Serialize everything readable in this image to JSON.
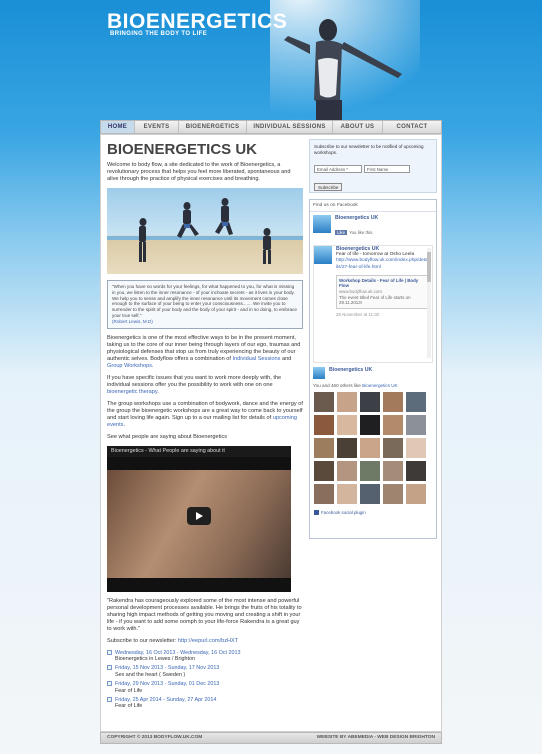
{
  "brand": {
    "logo": "BIOENERGETICS",
    "tagline": "BRINGING THE BODY TO LIFE"
  },
  "nav": [
    {
      "label": "HOME",
      "active": true
    },
    {
      "label": "EVENTS",
      "active": false
    },
    {
      "label": "BIOENERGETICS",
      "active": false
    },
    {
      "label": "INDIVIDUAL SESSIONS",
      "active": false
    },
    {
      "label": "ABOUT US",
      "active": false
    },
    {
      "label": "CONTACT",
      "active": false
    }
  ],
  "main": {
    "title": "BIOENERGETICS UK",
    "intro": "Welcome to body flow, a site dedicated to the work of Bioenergetics, a revolutionary process that helps you feel more liberated, spontaneous and alive through the practice of physical exercises and breathing.",
    "quote": "\"When you have no words for your feelings, for what happened to you, for what is missing in you, we listen to the inner resonance - of your inchoate secrets - as it lives in your body. We help you to sense and amplify the inner resonance until its movement comes close enough to the surface of your being to enter your consciousness....... We invite you to surrender to the spirit of your body and the body of your spirit - and in so doing, to embrace your true self.\"",
    "quote_author": "(Robert Lewis, M.D)",
    "p2_a": "Bioenergetics is one of the most effective ways to be in the present moment, taking us to the core of our inner being through layers of our ego, traumas and physiological defenses that stop us from truly experiencing the beauty of our authentic selves. Bodyflow offers a combination of ",
    "p2_link1": "Individual Sessions",
    "p2_b": " and ",
    "p2_link2": "Group Workshops",
    "p2_c": ".",
    "p3_a": "If you have specific issues that you want to work more deeply with, the individual sessions offer you the possibility to work with one on one ",
    "p3_link": "bioenergetic therapy",
    "p3_b": ".",
    "p4_a": "The group workshops use a combination of bodywork, dance and the energy of the group the bioenergetic workshops are a great way to come back to yourself and start loving life again. Sign up to a our mailing list for details of ",
    "p4_link": "upcoming events",
    "p4_b": ".",
    "p5": "See what people are saying about Bioenergetics",
    "video_title": "Bioenergetics - What People are saying about it",
    "testimonial": "\"Rakendra has courageously explored some of the most intense and powerful personal development processes available. He brings the fruits of his totality to sharing high impact methods of getting you moving and creating a shift in your life - if you want to add some oomph to your life-force Rakendra is a great guy to work with.\"",
    "subscribe_label": "Subscribe to our newsletter: ",
    "subscribe_link": "http://eepurl.com/bzHXT",
    "events": [
      {
        "date": "Wednesday, 16 Oct 2013 - Wednesday, 16 Oct 2013",
        "title": "Bioenergetics in Lewes / Brighton"
      },
      {
        "date": "Friday, 15 Nov 2013 - Sunday, 17 Nov 2013",
        "title": "Sex and the heart ( Sweden )"
      },
      {
        "date": "Friday, 29 Nov 2013 - Sunday, 01 Dec 2013",
        "title": "Fear of Life"
      },
      {
        "date": "Friday, 25 Apr 2014 - Sunday, 27 Apr 2014",
        "title": "Fear of Life"
      }
    ]
  },
  "sidebar": {
    "newsletter_text": "Subscribe to our newsletter to be notified of upcoming workshops.",
    "email_placeholder": "Email Address *",
    "firstname_placeholder": "First Name",
    "subscribe_button": "Subscribe",
    "fb_heading": "Find us on Facebook",
    "fb_page": "Bioenergetics UK",
    "fb_like": "Like",
    "fb_likes_text": "You like this.",
    "post_author": "Bioenergetics UK",
    "post_text": "Fear of life - tomorrow at Osho Leela",
    "post_link": "http://www.bodyflow.uk.com/index.php/details/27-fear-of-life.html",
    "share_title": "Workshop Details - Fear of Life | Body Flow",
    "share_domain": "www.bodyflow.uk.com",
    "share_desc": "The event titled Fear of Life starts on 29.11.2013!",
    "post_time": "28 November at 11:30",
    "post2_author": "Bioenergetics UK",
    "fans_text": "You and 460 others like ",
    "fans_link": "Bioenergetics UK",
    "social_plugin": "Facebook social plugin"
  },
  "footer": {
    "copyright": "COPYRIGHT © 2013 BODYFLOW.UK.COM",
    "credit": "WEBSITE BY ABEMEDIA - WEB DESIGN BRIGHTON"
  }
}
